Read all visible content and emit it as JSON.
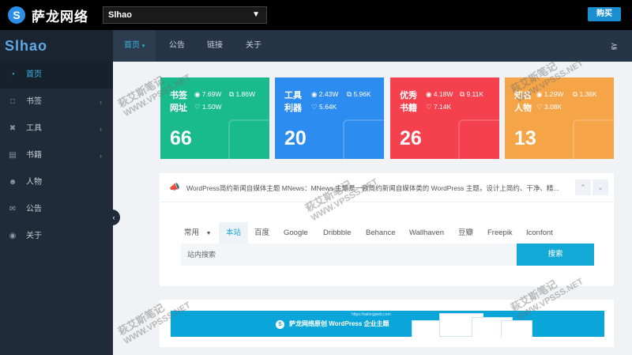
{
  "topbar": {
    "logo_letter": "S",
    "logo_text": "萨龙网络",
    "site_select_value": "Slhao",
    "buy_label": "购买"
  },
  "sidebar": {
    "brand": "Slhao",
    "items": [
      {
        "label": "首页",
        "icon": "dashboard-icon",
        "active": true,
        "has_arrow": false
      },
      {
        "label": "书签",
        "icon": "bookmark-icon",
        "active": false,
        "has_arrow": true
      },
      {
        "label": "工具",
        "icon": "tools-icon",
        "active": false,
        "has_arrow": true
      },
      {
        "label": "书籍",
        "icon": "book-icon",
        "active": false,
        "has_arrow": true
      },
      {
        "label": "人物",
        "icon": "user-icon",
        "active": false,
        "has_arrow": false
      },
      {
        "label": "公告",
        "icon": "mail-icon",
        "active": false,
        "has_arrow": false
      },
      {
        "label": "关于",
        "icon": "about-icon",
        "active": false,
        "has_arrow": false
      }
    ]
  },
  "nav": {
    "tabs": [
      {
        "label": "首页",
        "active": true
      },
      {
        "label": "公告",
        "active": false
      },
      {
        "label": "链接",
        "active": false
      },
      {
        "label": "关于",
        "active": false
      }
    ]
  },
  "cards": [
    {
      "title1": "书签",
      "title2": "网址",
      "views": "7.69W",
      "shares": "1.86W",
      "likes": "1.50W",
      "count": "66",
      "color": "#19ba8b"
    },
    {
      "title1": "工具",
      "title2": "利器",
      "views": "2.43W",
      "shares": "5.96K",
      "likes": "5.64K",
      "count": "20",
      "color": "#2d8cf0"
    },
    {
      "title1": "优秀",
      "title2": "书籍",
      "views": "4.18W",
      "shares": "9.11K",
      "likes": "7.14K",
      "count": "26",
      "color": "#f4414d"
    },
    {
      "title1": "知名",
      "title2": "人物",
      "views": "1.29W",
      "shares": "1.36K",
      "likes": "3.08K",
      "count": "13",
      "color": "#f5a548"
    }
  ],
  "news": {
    "text": "WordPress简约新闻自媒体主题 MNews：MNews 主题是一款简约新闻自媒体类的 WordPress 主题，设计上简约、干净、精..."
  },
  "search": {
    "category": "常用",
    "engines": [
      {
        "label": "本站",
        "active": true
      },
      {
        "label": "百度",
        "active": false
      },
      {
        "label": "Google",
        "active": false
      },
      {
        "label": "Dribbble",
        "active": false
      },
      {
        "label": "Behance",
        "active": false
      },
      {
        "label": "Wallhaven",
        "active": false
      },
      {
        "label": "豆瓣",
        "active": false
      },
      {
        "label": "Freepik",
        "active": false
      },
      {
        "label": "Iconfont",
        "active": false
      }
    ],
    "placeholder": "站内搜索",
    "button": "搜索"
  },
  "banner": {
    "url": "https://salongweb.com",
    "text": "萨龙网络原创 WordPress 企业主题"
  },
  "watermark": {
    "line1": "萩艾斯笔记",
    "line2": "WWW.VPSSS.NET"
  }
}
